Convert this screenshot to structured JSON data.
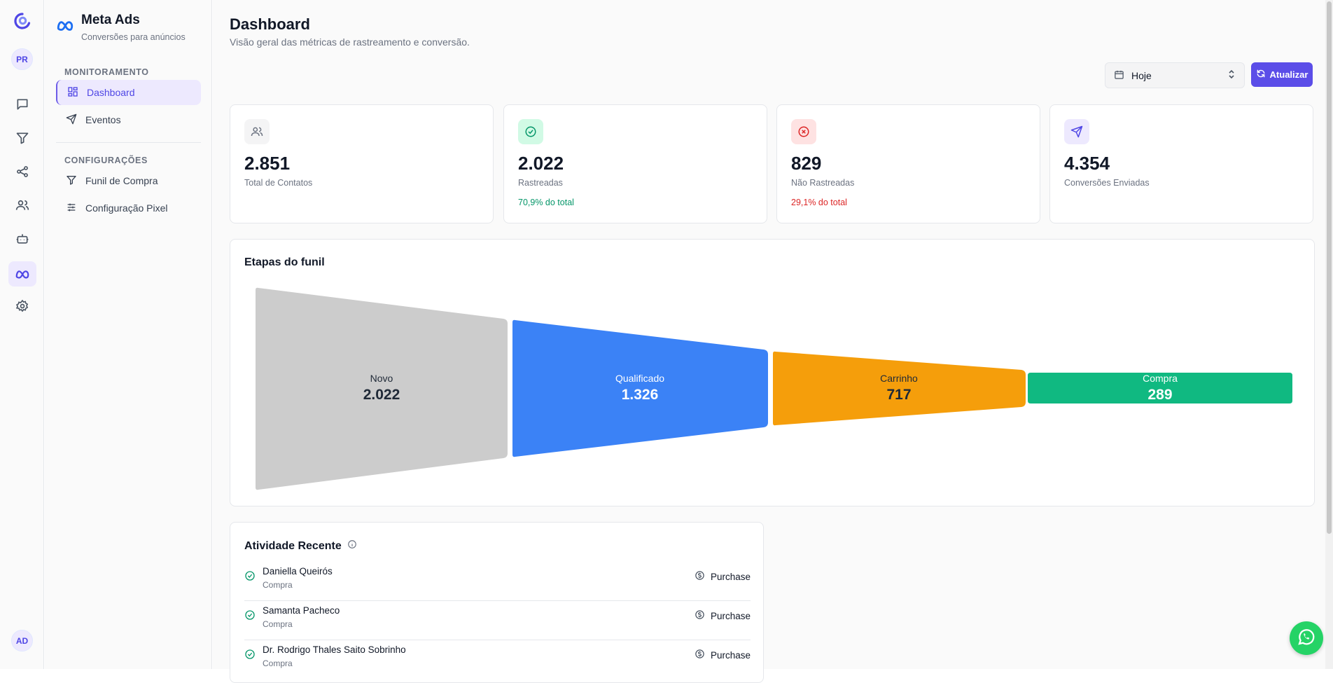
{
  "rail": {
    "workspace_initials": "PR",
    "user_initials": "AD",
    "icons": [
      "logo-icon",
      "chat-icon",
      "filter-icon",
      "share-icon",
      "users-icon",
      "bot-icon",
      "meta-icon",
      "gear-icon"
    ]
  },
  "sidebar": {
    "title": "Meta Ads",
    "subtitle": "Conversões para anúncios",
    "section_monitoring": "MONITORAMENTO",
    "section_config": "CONFIGURAÇÕES",
    "items": [
      {
        "label": "Dashboard",
        "icon": "grid-icon",
        "active": true
      },
      {
        "label": "Eventos",
        "icon": "send-icon",
        "active": false
      },
      {
        "label": "Funil de Compra",
        "icon": "filter-icon",
        "active": false
      },
      {
        "label": "Configuração Pixel",
        "icon": "sliders-icon",
        "active": false
      }
    ]
  },
  "header": {
    "title": "Dashboard",
    "subtitle": "Visão geral das métricas de rastreamento e conversão.",
    "date_select": "Hoje",
    "refresh_label": "Atualizar"
  },
  "stats": [
    {
      "value": "2.851",
      "label": "Total de Contatos",
      "pct": "",
      "icon": "users-icon",
      "color": "#6b7280"
    },
    {
      "value": "2.022",
      "label": "Rastreadas",
      "pct": "70,9% do total",
      "icon": "check-circle-icon",
      "color": "#059669"
    },
    {
      "value": "829",
      "label": "Não Rastreadas",
      "pct": "29,1% do total",
      "icon": "x-circle-icon",
      "color": "#dc2626"
    },
    {
      "value": "4.354",
      "label": "Conversões Enviadas",
      "pct": "",
      "icon": "send-icon",
      "color": "#4f46e5"
    }
  ],
  "funnel": {
    "title": "Etapas do funil",
    "stages": [
      {
        "label": "Novo",
        "value": "2.022",
        "color": "#cccccc",
        "text_color": "#1f2937"
      },
      {
        "label": "Qualificado",
        "value": "1.326",
        "color": "#3b82f6",
        "text_color": "#ffffff"
      },
      {
        "label": "Carrinho",
        "value": "717",
        "color": "#f59e0b",
        "text_color": "#1f2937"
      },
      {
        "label": "Compra",
        "value": "289",
        "color": "#10b981",
        "text_color": "#ffffff"
      }
    ]
  },
  "activity": {
    "title": "Atividade Recente",
    "rows": [
      {
        "name": "Daniella Queirós",
        "type": "Compra",
        "event": "Purchase"
      },
      {
        "name": "Samanta Pacheco",
        "type": "Compra",
        "event": "Purchase"
      },
      {
        "name": "Dr. Rodrigo Thales Saito Sobrinho",
        "type": "Compra",
        "event": "Purchase"
      }
    ]
  }
}
